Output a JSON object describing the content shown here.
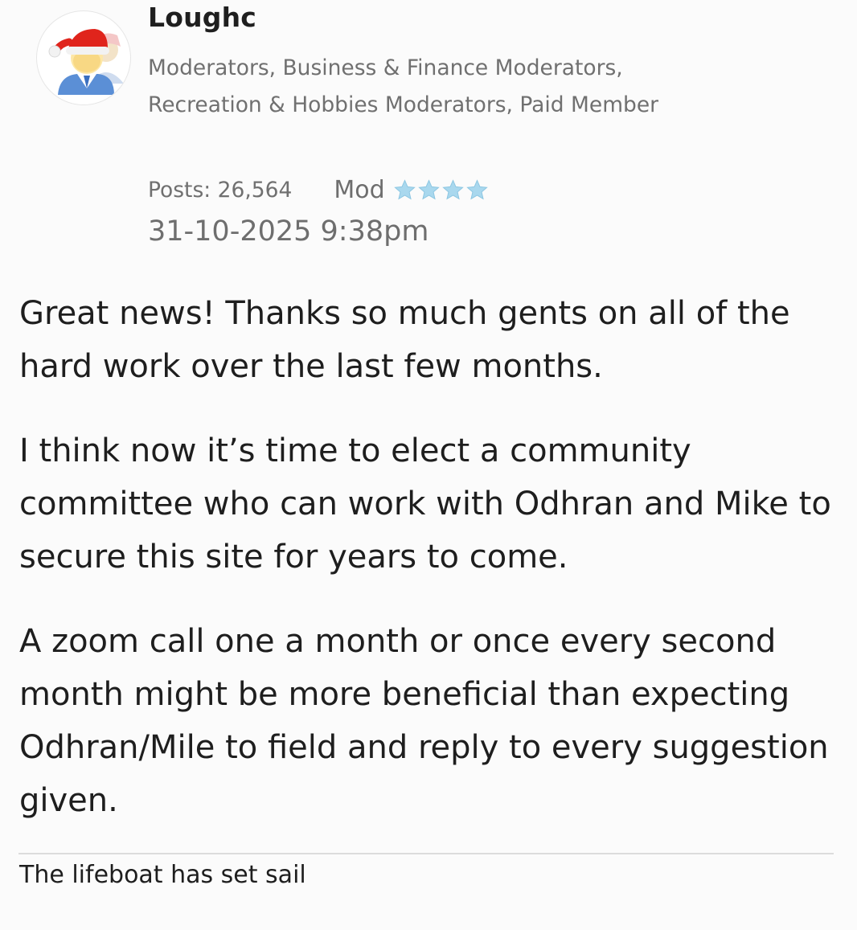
{
  "author": {
    "username": "Loughc",
    "avatar_icon": "santa-hat-user-icon",
    "ranks": "Moderators, Business & Finance Moderators, Recreation & Hobbies Moderators, Paid Member",
    "posts_label": "Posts: 26,564",
    "rank_title": "Mod",
    "rank_stars": 4,
    "star_color": "#a9d8ee"
  },
  "post": {
    "timestamp": "31-10-2025 9:38pm",
    "paragraphs": [
      "Great news! Thanks so much gents on all of the hard work over the last few months.",
      "I think now it’s time to elect a community committee who can work with Odhran and Mike to secure this site for years to come.",
      "A zoom call one a month or once every second month might be more beneficial than expecting Odhran/Mile to field and reply to every suggestion given."
    ],
    "signature": "The lifeboat has set sail"
  }
}
